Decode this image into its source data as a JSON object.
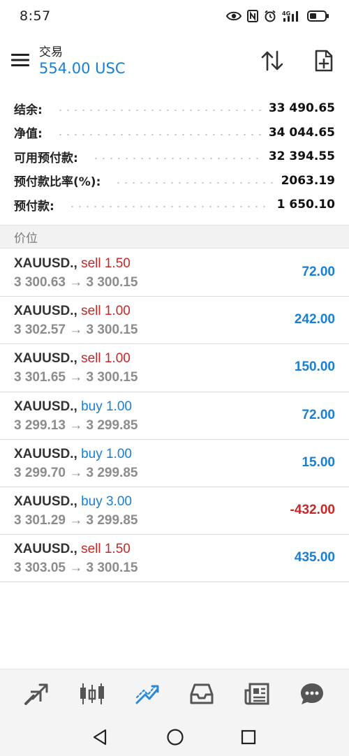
{
  "status_bar": {
    "time": "8:57",
    "icons": [
      "eye-icon",
      "nfc-icon",
      "alarm-icon",
      "signal-4g-icon",
      "battery-icon"
    ],
    "network": "4G"
  },
  "header": {
    "title": "交易",
    "balance": "554.00 USC"
  },
  "summary": {
    "rows": [
      {
        "label": "结余:",
        "value": "33 490.65"
      },
      {
        "label": "净值:",
        "value": "34 044.65"
      },
      {
        "label": "可用预付款:",
        "value": "32 394.55"
      },
      {
        "label": "预付款比率(%):",
        "value": "2063.19"
      },
      {
        "label": "预付款:",
        "value": "1 650.10"
      }
    ]
  },
  "section": {
    "title": "价位"
  },
  "positions": [
    {
      "symbol": "XAUUSD.,",
      "type": "sell 1.50",
      "side": "sell",
      "prices": "3 300.63 → 3 300.15",
      "profit": "72.00",
      "profit_sign": "pos"
    },
    {
      "symbol": "XAUUSD.,",
      "type": "sell 1.00",
      "side": "sell",
      "prices": "3 302.57 → 3 300.15",
      "profit": "242.00",
      "profit_sign": "pos"
    },
    {
      "symbol": "XAUUSD.,",
      "type": "sell 1.00",
      "side": "sell",
      "prices": "3 301.65 → 3 300.15",
      "profit": "150.00",
      "profit_sign": "pos"
    },
    {
      "symbol": "XAUUSD.,",
      "type": "buy 1.00",
      "side": "buy",
      "prices": "3 299.13 → 3 299.85",
      "profit": "72.00",
      "profit_sign": "pos"
    },
    {
      "symbol": "XAUUSD.,",
      "type": "buy 1.00",
      "side": "buy",
      "prices": "3 299.70 → 3 299.85",
      "profit": "15.00",
      "profit_sign": "pos"
    },
    {
      "symbol": "XAUUSD.,",
      "type": "buy 3.00",
      "side": "buy",
      "prices": "3 301.29 → 3 299.85",
      "profit": "-432.00",
      "profit_sign": "neg"
    },
    {
      "symbol": "XAUUSD.,",
      "type": "sell 1.50",
      "side": "sell",
      "prices": "3 303.05 → 3 300.15",
      "profit": "435.00",
      "profit_sign": "pos"
    }
  ],
  "tabs": [
    {
      "icon": "quotes-icon",
      "active": false
    },
    {
      "icon": "chart-icon",
      "active": false
    },
    {
      "icon": "trade-icon",
      "active": true
    },
    {
      "icon": "history-icon",
      "active": false
    },
    {
      "icon": "news-icon",
      "active": false
    },
    {
      "icon": "messages-icon",
      "active": false
    }
  ],
  "colors": {
    "accent": "#1a7fd1",
    "sell": "#c62828",
    "buy": "#1a7fd1",
    "negative": "#c62828",
    "muted": "#8c8c8c",
    "tab_icon": "#555555",
    "tab_active": "#2a8ad8"
  }
}
